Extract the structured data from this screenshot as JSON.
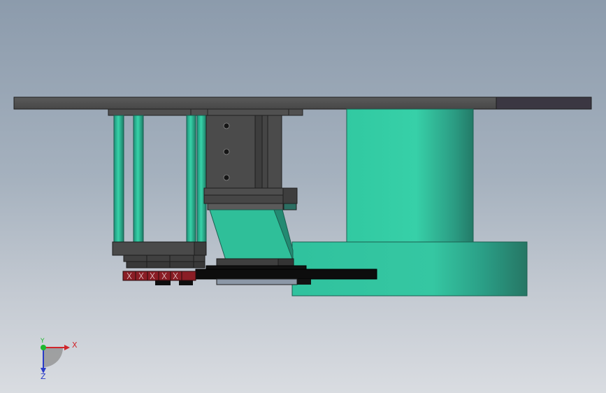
{
  "window": {
    "view": "cad-3d-viewport"
  },
  "colors": {
    "background_top": "#8c9bac",
    "background_bottom": "#d9dce1",
    "plate": "#4f4f4f",
    "plate_dark": "#3a3640",
    "teal": "#2ec9a0",
    "teal_dark": "#23806e",
    "block": "#4a4a4a",
    "black_part": "#0d0d0d",
    "red_part": "#8a1d25"
  },
  "triad": {
    "x_label": "X",
    "y_label": "Y",
    "z_label": "Z",
    "x_color": "#d0262b",
    "y_color": "#1db82f",
    "z_color": "#2a3bc8"
  }
}
